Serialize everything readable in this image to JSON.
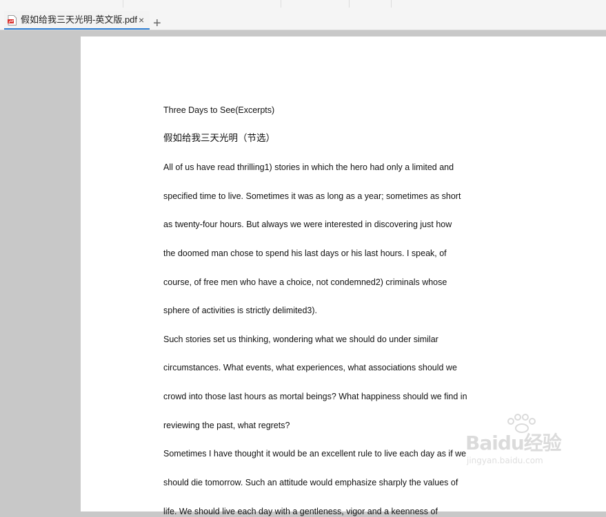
{
  "tab": {
    "title": "假如给我三天光明-英文版.pdf",
    "close_glyph": "×",
    "icon": "pdf-file-icon"
  },
  "new_tab_glyph": "+",
  "document": {
    "title_en": "Three Days to See(Excerpts)",
    "title_zh": "假如给我三天光明（节选）",
    "lines": [
      "All of us have read thrilling1) stories in which the hero had only a limited and",
      "specified time to live. Sometimes it was as long as a year; sometimes as short",
      "as twenty-four hours. But always we were interested in discovering just how",
      "the doomed man chose to spend his last days or his last hours. I speak, of",
      "course, of free men who have a choice, not condemned2) criminals whose",
      "sphere of activities is strictly delimited3).",
      "Such stories set us thinking, wondering what we should do under similar",
      "circumstances. What events, what experiences, what associations should we",
      "crowd into those last hours as mortal beings? What happiness should we find in",
      "reviewing the past, what regrets?",
      "Sometimes I have thought it would be an excellent rule to live each day as if we",
      "should die tomorrow. Such an attitude would emphasize sharply the values of",
      "life. We should live each day with a gentleness, vigor and a keenness of"
    ]
  },
  "watermark": {
    "logo_text": "Baidu经验",
    "url_text": "jingyan.baidu.com"
  },
  "colors": {
    "viewer_background": "#c8c8c8",
    "page_background": "#ffffff",
    "tab_accent": "#2d7fd4",
    "pdf_icon": "#d9302c"
  }
}
